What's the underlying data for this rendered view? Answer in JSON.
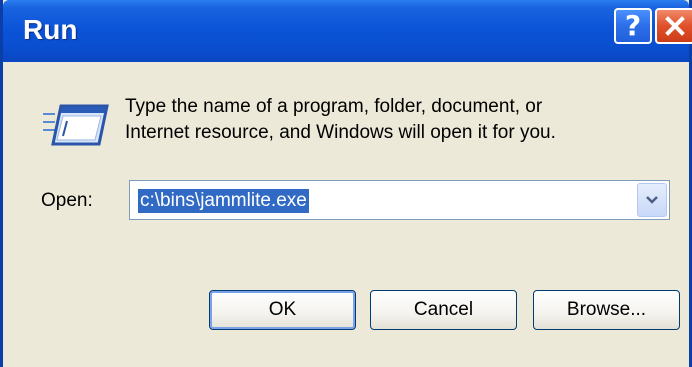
{
  "window": {
    "title": "Run",
    "help_glyph": "?",
    "titlebar_color": "#0a4fd0",
    "close_color": "#e0502a"
  },
  "content": {
    "icon": "run-icon",
    "description_line1": "Type the name of a program, folder, document, or",
    "description_line2": "Internet resource, and Windows will open it for you."
  },
  "open_field": {
    "label": "Open:",
    "value": "c:\\bins\\jammlite.exe",
    "selection_color": "#316ac5"
  },
  "buttons": {
    "ok_label": "OK",
    "cancel_label": "Cancel",
    "browse_label": "Browse..."
  }
}
